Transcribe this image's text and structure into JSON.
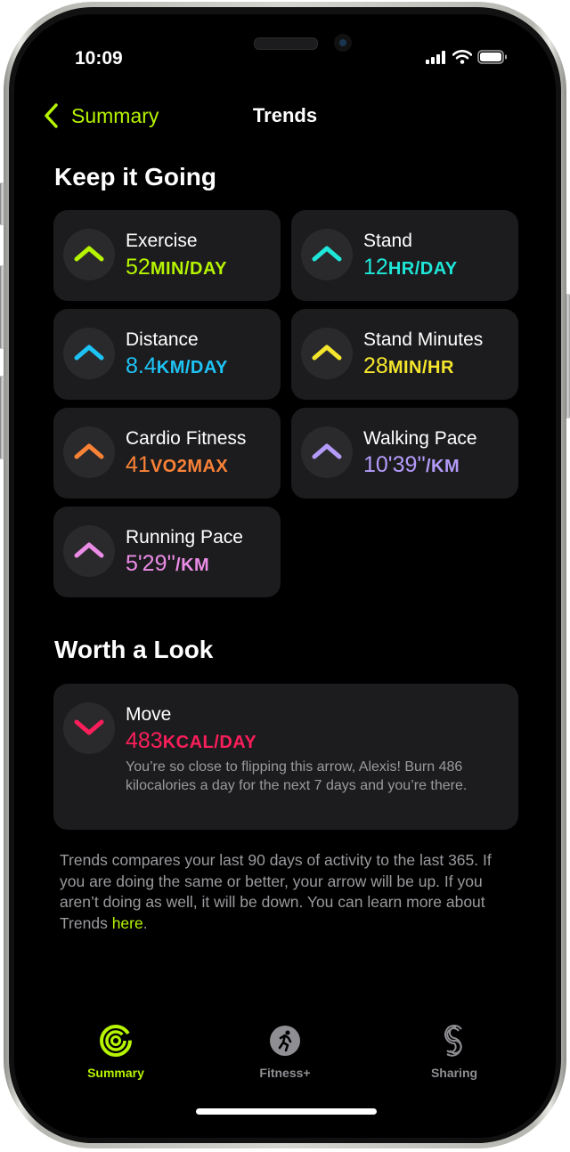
{
  "status_bar": {
    "time": "10:09"
  },
  "nav": {
    "back_label": "Summary",
    "title": "Trends"
  },
  "sections": {
    "keep_going": {
      "title": "Keep it Going",
      "cards": [
        {
          "title": "Exercise",
          "value": "52",
          "unit": "MIN/DAY",
          "direction": "up",
          "color": "#b6f400"
        },
        {
          "title": "Stand",
          "value": "12",
          "unit": "HR/DAY",
          "direction": "up",
          "color": "#1ee6d8"
        },
        {
          "title": "Distance",
          "value": "8.4",
          "unit": "KM/DAY",
          "direction": "up",
          "color": "#1ec3f5"
        },
        {
          "title": "Stand Minutes",
          "value": "28",
          "unit": "MIN/HR",
          "direction": "up",
          "color": "#f5e62d"
        },
        {
          "title": "Cardio Fitness",
          "value": "41",
          "unit": "VO2MAX",
          "direction": "up",
          "color": "#fa8237"
        },
        {
          "title": "Walking Pace",
          "value": "10'39''",
          "unit": "/KM",
          "direction": "up",
          "color": "#b49bfa"
        },
        {
          "title": "Running Pace",
          "value": "5'29''",
          "unit": "/KM",
          "direction": "up",
          "color": "#eb8ce6"
        }
      ]
    },
    "worth_look": {
      "title": "Worth a Look",
      "cards": [
        {
          "title": "Move",
          "value": "483",
          "unit": "KCAL/DAY",
          "direction": "down",
          "color": "#fa1e5a",
          "description": "You’re so close to flipping this arrow, Alexis! Burn 486 kilocalories a day for the next 7 days and you’re there."
        }
      ]
    }
  },
  "footnote": {
    "text": "Trends compares your last 90 days of activity to the last 365. If you are doing the same or better, your arrow will be up. If you aren’t doing as well, it will be down. You can learn more about Trends ",
    "link": "here",
    "end": "."
  },
  "tab_bar": {
    "tabs": [
      {
        "label": "Summary",
        "icon": "activity-rings-icon",
        "active": true
      },
      {
        "label": "Fitness+",
        "icon": "fitness-plus-icon",
        "active": false
      },
      {
        "label": "Sharing",
        "icon": "sharing-icon",
        "active": false
      }
    ],
    "active_color": "#b6f400",
    "inactive_color": "#8e8e93"
  }
}
